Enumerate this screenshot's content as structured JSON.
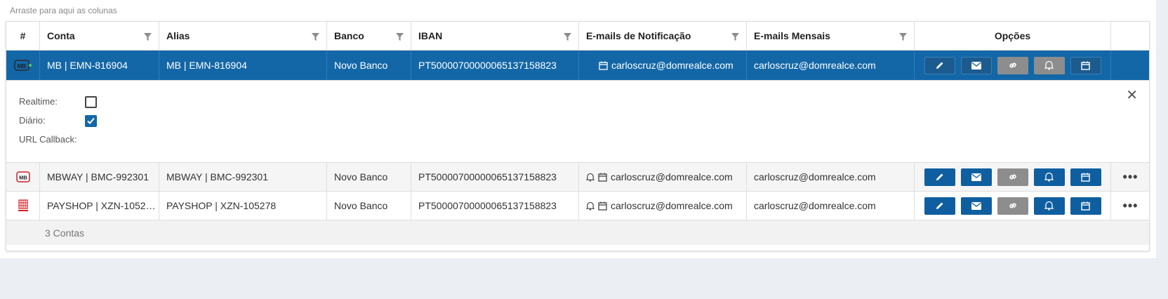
{
  "group_hint": "Arraste para aqui as colunas",
  "columns": {
    "index": "#",
    "conta": "Conta",
    "alias": "Alias",
    "banco": "Banco",
    "iban": "IBAN",
    "emails_notificacao": "E-mails de Notificação",
    "emails_mensais": "E-mails Mensais",
    "opcoes": "Opções"
  },
  "rows": [
    {
      "logo": "mb-logo",
      "conta": "MB | EMN-816904",
      "alias": "MB | EMN-816904",
      "banco": "Novo Banco",
      "iban": "PT50000700000065137158823",
      "email_notificacao": "carloscruz@domrealce.com",
      "email_mensal": "carloscruz@domrealce.com",
      "selected": true
    },
    {
      "logo": "mbway-logo",
      "conta": "MBWAY | BMC-992301",
      "alias": "MBWAY | BMC-992301",
      "banco": "Novo Banco",
      "iban": "PT50000700000065137158823",
      "email_notificacao": "carloscruz@domrealce.com",
      "email_mensal": "carloscruz@domrealce.com",
      "selected": false
    },
    {
      "logo": "payshop-logo",
      "conta": "PAYSHOP | XZN-1052…",
      "alias": "PAYSHOP | XZN-105278",
      "banco": "Novo Banco",
      "iban": "PT50000700000065137158823",
      "email_notificacao": "carloscruz@domrealce.com",
      "email_mensal": "carloscruz@domrealce.com",
      "selected": false
    }
  ],
  "detail": {
    "realtime_label": "Realtime:",
    "realtime_checked": false,
    "diario_label": "Diário:",
    "diario_checked": true,
    "url_callback_label": "URL Callback:",
    "url_callback_value": ""
  },
  "more_glyph": "•••",
  "footer": {
    "count": "3 Contas"
  },
  "colors": {
    "selected_row": "#1367a7",
    "button_blue": "#0f5fa0",
    "button_gray": "#8d8d8d",
    "background": "#ebeef3"
  },
  "option_buttons": [
    "edit-icon",
    "envelope-icon",
    "link-icon",
    "bell-icon",
    "calendar-icon"
  ]
}
